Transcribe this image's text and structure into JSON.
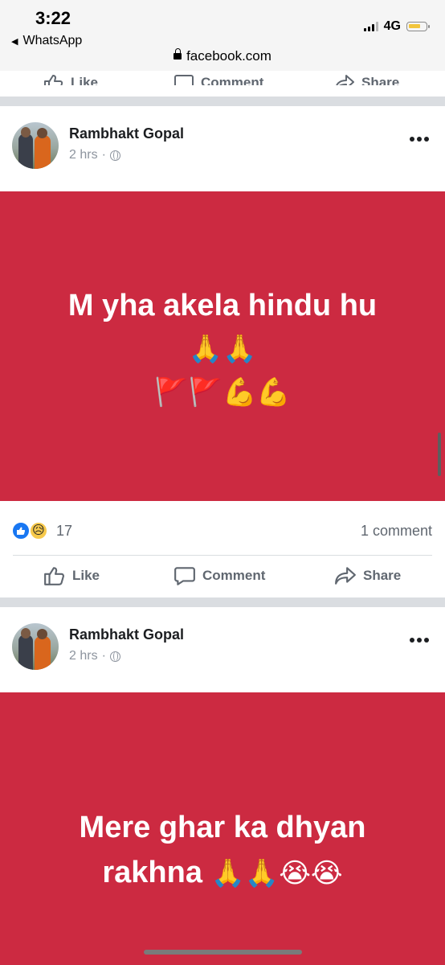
{
  "status_bar": {
    "time": "3:22",
    "back_app": "WhatsApp",
    "network": "4G",
    "url": "facebook.com"
  },
  "actions": {
    "like": "Like",
    "comment": "Comment",
    "share": "Share"
  },
  "posts": [
    {
      "author": "Rambhakt Gopal",
      "time": "2 hrs",
      "text": "M yha akela hindu hu",
      "emoji_line_1": "🙏🙏",
      "emoji_line_2": "🚩🚩💪💪",
      "background_color": "#cc2a41",
      "reaction_count": "17",
      "comment_count": "1 comment"
    },
    {
      "author": "Rambhakt Gopal",
      "time": "2 hrs",
      "text_line_1": "Mere ghar ka dhyan",
      "text_line_2": "rakhna",
      "text_emoji": "🙏🙏😭😭",
      "background_color": "#cc2a41"
    }
  ],
  "icons": {
    "like": "thumbs-up-icon",
    "comment": "speech-bubble-icon",
    "share": "share-arrow-icon",
    "privacy": "globe-icon",
    "more": "more-dots-icon",
    "reaction_like": "like-reaction-icon",
    "reaction_sad": "sad-reaction-icon"
  }
}
